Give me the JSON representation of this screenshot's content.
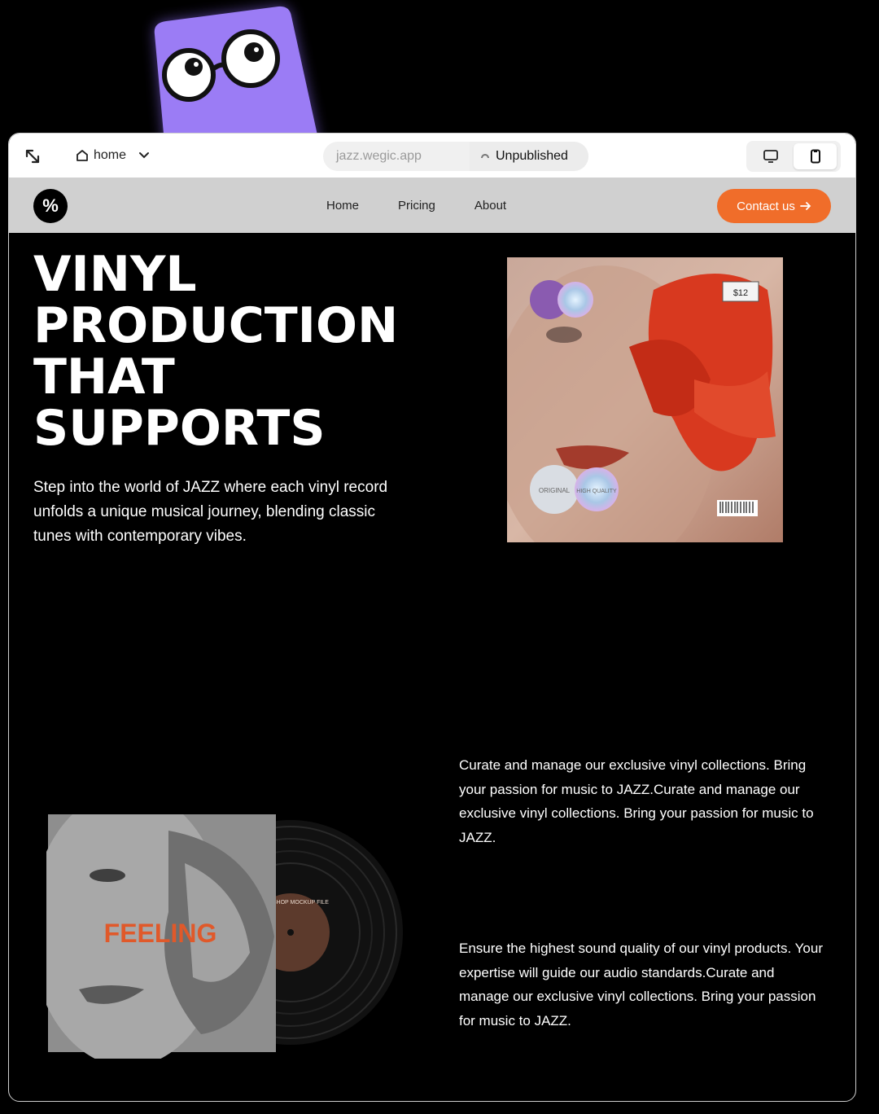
{
  "toolbar": {
    "page_selector": "home",
    "url": "jazz.wegic.app",
    "status": "Unpublished",
    "icons": [
      "collapse-icon",
      "home-icon",
      "chevron-down-icon",
      "desktop-icon",
      "mobile-icon"
    ]
  },
  "nav": {
    "logo": "%",
    "links": [
      "Home",
      "Pricing",
      "About"
    ],
    "cta": "Contact us"
  },
  "hero": {
    "title": "VINYL\nPRODUCTION\nTHAT\nSUPPORTS",
    "description": "Step into the world of JAZZ where each vinyl record unfolds a unique musical journey, blending classic tunes with contemporary vibes.",
    "cover_price": "$12",
    "sticker_left": "ORIGINAL",
    "sticker_right": "HIGH QUALITY"
  },
  "features": {
    "album_word": "FEELING",
    "record_label_text": "PHOTOSHOP MOCKUP FILE",
    "paragraph_1": "Curate and manage our exclusive vinyl collections. Bring your passion for music to JAZZ.Curate and manage our exclusive vinyl collections. Bring your passion for music to JAZZ.",
    "paragraph_2": "Ensure the highest sound quality of our vinyl products. Your expertise will guide our audio standards.Curate and manage our exclusive vinyl collections. Bring your passion for music to JAZZ."
  },
  "colors": {
    "accent": "#f06d2a",
    "mascot": "#9b7cf5",
    "nav_bg": "#d0d0d0"
  }
}
